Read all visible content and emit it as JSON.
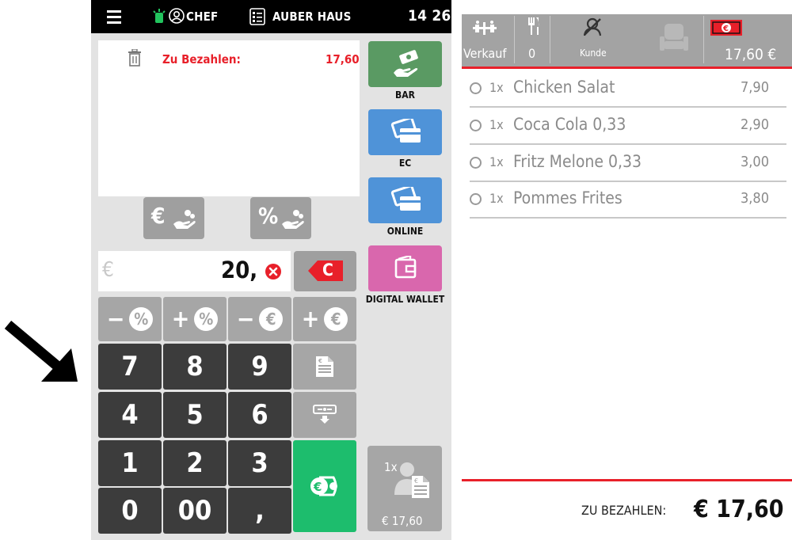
{
  "topbar": {
    "user": "CHEF",
    "mode": "AUBER HAUS",
    "time": "14 26"
  },
  "receipt": {
    "label": "Zu Bezahlen:",
    "amount": "17,60"
  },
  "input": {
    "currency": "€",
    "value": "20,"
  },
  "clear_label": "C",
  "modifiers": [
    {
      "sign": "−",
      "unit": "%"
    },
    {
      "sign": "+",
      "unit": "%"
    },
    {
      "sign": "−",
      "unit": "€"
    },
    {
      "sign": "+",
      "unit": "€"
    }
  ],
  "keys": [
    "7",
    "8",
    "9",
    "4",
    "5",
    "6",
    "1",
    "2",
    "3",
    "0",
    "00",
    ","
  ],
  "payments": [
    {
      "label": "BAR",
      "color": "#5a9a63"
    },
    {
      "label": "EC",
      "color": "#4f93d8"
    },
    {
      "label": "ONLINE",
      "color": "#4f93d8"
    },
    {
      "label": "DIGITAL WALLET",
      "color": "#d967ad"
    }
  ],
  "split": {
    "count": "1x",
    "amount": "€ 17,60"
  },
  "header": {
    "sale_label": "Verkauf",
    "guests": "0",
    "customer": "Kunde",
    "total": "17,60 €"
  },
  "items": [
    {
      "qty": "1x",
      "name": "Chicken Salat",
      "price": "7,90"
    },
    {
      "qty": "1x",
      "name": "Coca Cola 0,33",
      "price": "2,90"
    },
    {
      "qty": "1x",
      "name": "Fritz Melone 0,33",
      "price": "3,00"
    },
    {
      "qty": "1x",
      "name": "Pommes Frites",
      "price": "3,80"
    }
  ],
  "footer": {
    "label": "ZU BEZAHLEN:",
    "total": "€ 17,60"
  },
  "colors": {
    "accent_red": "#e8202a",
    "dark_key": "#3c3c3c",
    "confirm_green": "#1dbd6d"
  }
}
